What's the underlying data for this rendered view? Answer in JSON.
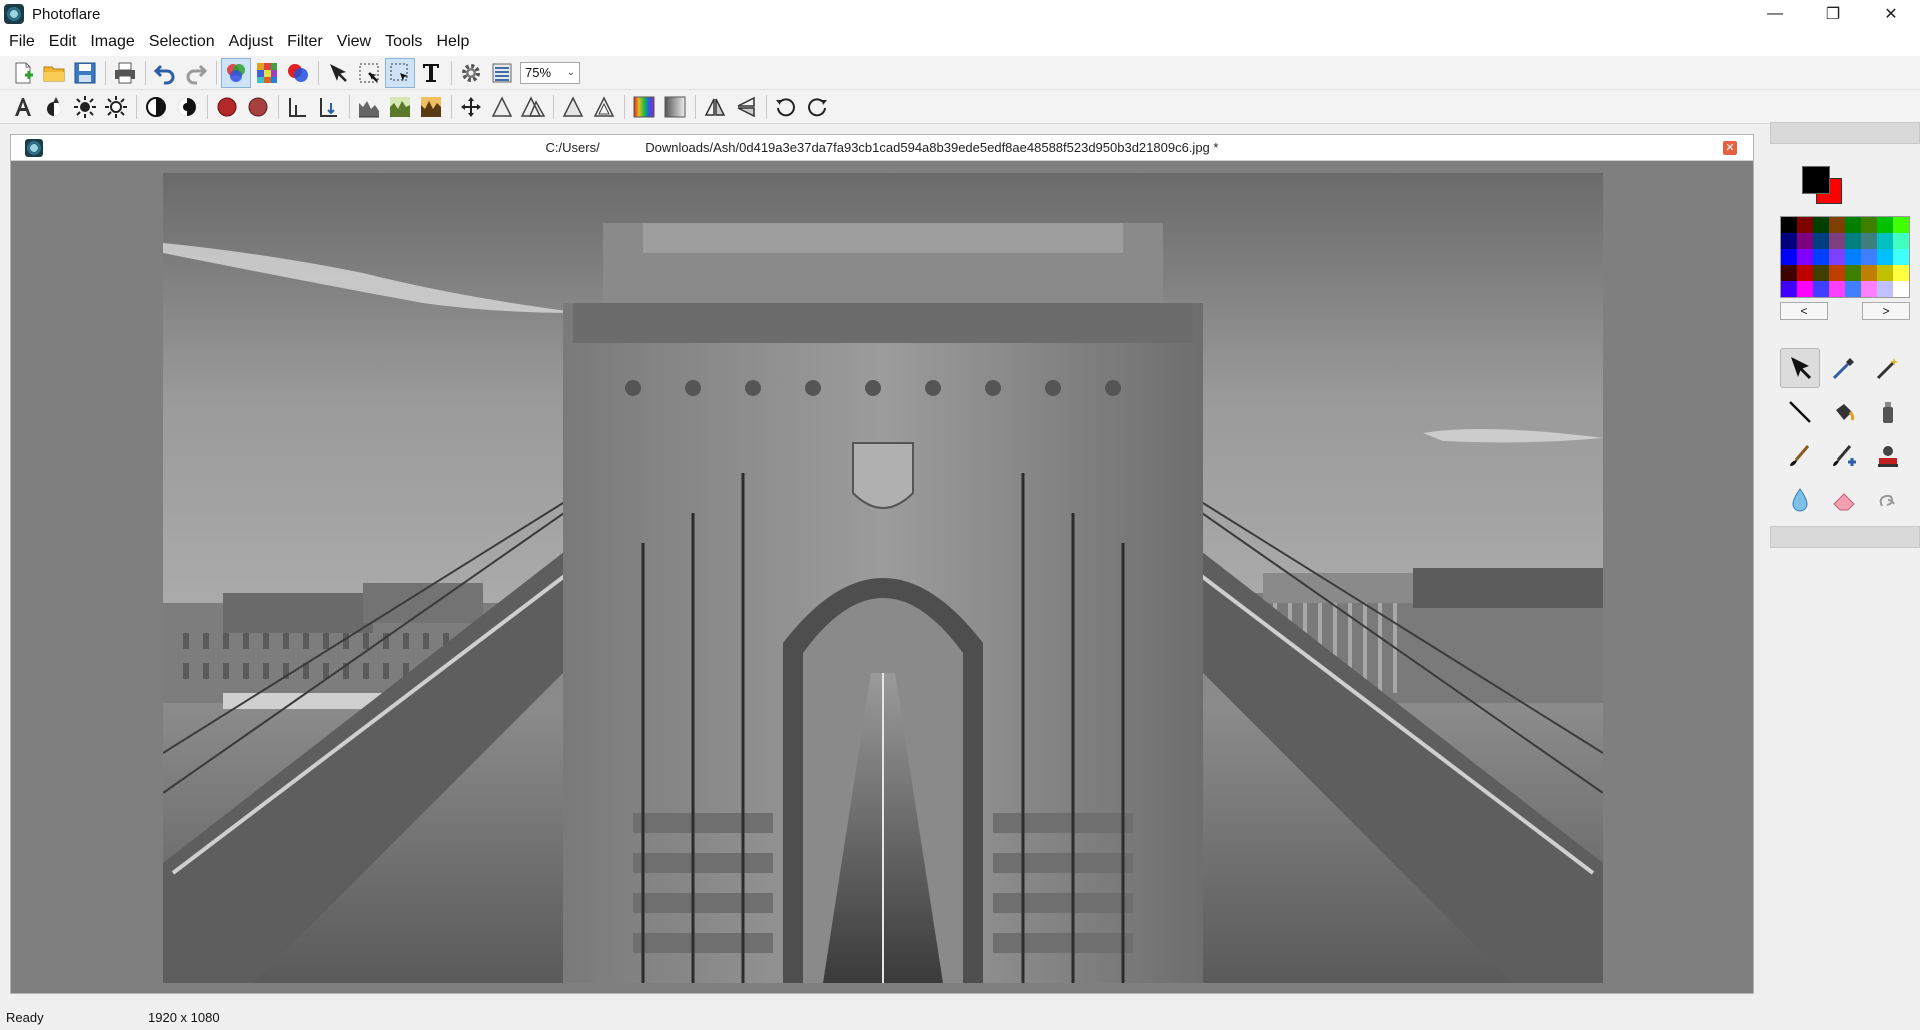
{
  "window": {
    "title": "Photoflare",
    "minimize_glyph": "—",
    "restore_glyph": "❐",
    "close_glyph": "✕"
  },
  "menu": [
    "File",
    "Edit",
    "Image",
    "Selection",
    "Adjust",
    "Filter",
    "View",
    "Tools",
    "Help"
  ],
  "toolbar1": {
    "icons": [
      "new-file-icon",
      "open-folder-icon",
      "save-icon",
      "print-icon",
      "undo-icon",
      "redo-icon",
      "color-channels-icon",
      "mosaic-icon",
      "color-circles-icon",
      "pointer-icon",
      "crop-icon",
      "select-rect-icon",
      "text-icon",
      "gear-icon",
      "layers-icon"
    ],
    "zoom_value": "75%",
    "zoom_arrow": "⌄"
  },
  "toolbar2": {
    "icons": [
      "auto-levels-icon",
      "auto-contrast-icon",
      "brightness-up-icon",
      "brightness-down-icon",
      "contrast-up-icon",
      "contrast-down-icon",
      "saturation-up-icon",
      "saturation-down-icon",
      "gamma-up-icon",
      "gamma-down-icon",
      "histogram-icon",
      "histogram-green-icon",
      "histogram-warm-icon",
      "move-icon",
      "sharpen-icon",
      "soften-icon",
      "triangle-icon",
      "triangle-outline-icon",
      "color-gradient-icon",
      "grayscale-gradient-icon",
      "flip-horizontal-icon",
      "flip-vertical-icon",
      "rotate-ccw-icon",
      "rotate-cw-icon"
    ]
  },
  "document": {
    "path": "C:/Users/       Downloads/Ash/0d419a3e37da7fa93cb1cad594a8b39ede5edf8ae48588f523d950b3d21809c6.jpg *",
    "close_glyph": "✕"
  },
  "colors": {
    "foreground": "#000000",
    "background": "#ff0000",
    "palette": [
      "#000000",
      "#7f0000",
      "#003f00",
      "#7f3f00",
      "#007f00",
      "#3f7f00",
      "#00c000",
      "#40ff00",
      "#00007f",
      "#7f007f",
      "#003f7f",
      "#7f3f7f",
      "#007f7f",
      "#3f7f7f",
      "#00c0c0",
      "#40ffc0",
      "#0000ff",
      "#7f00ff",
      "#003fff",
      "#7f3fff",
      "#007fff",
      "#3f7fff",
      "#00c0ff",
      "#40ffff",
      "#3f0000",
      "#bf0000",
      "#3f3f00",
      "#bf3f00",
      "#3f7f00",
      "#bf7f00",
      "#c0c000",
      "#ffff40",
      "#3f00ff",
      "#ff00ff",
      "#3f3fff",
      "#ff3fff",
      "#3f7fff",
      "#ff7fff",
      "#c0c0ff",
      "#ffffff"
    ],
    "prev_label": "<",
    "next_label": ">"
  },
  "tools": [
    "pointer-tool-icon",
    "color-picker-icon",
    "magic-wand-icon",
    "line-icon",
    "paint-bucket-icon",
    "spray-can-icon",
    "paint-brush-icon",
    "brush-plus-icon",
    "stamp-icon",
    "blur-drop-icon",
    "eraser-icon",
    "smudge-icon"
  ],
  "status": {
    "state": "Ready",
    "dimensions": "1920 x 1080"
  }
}
